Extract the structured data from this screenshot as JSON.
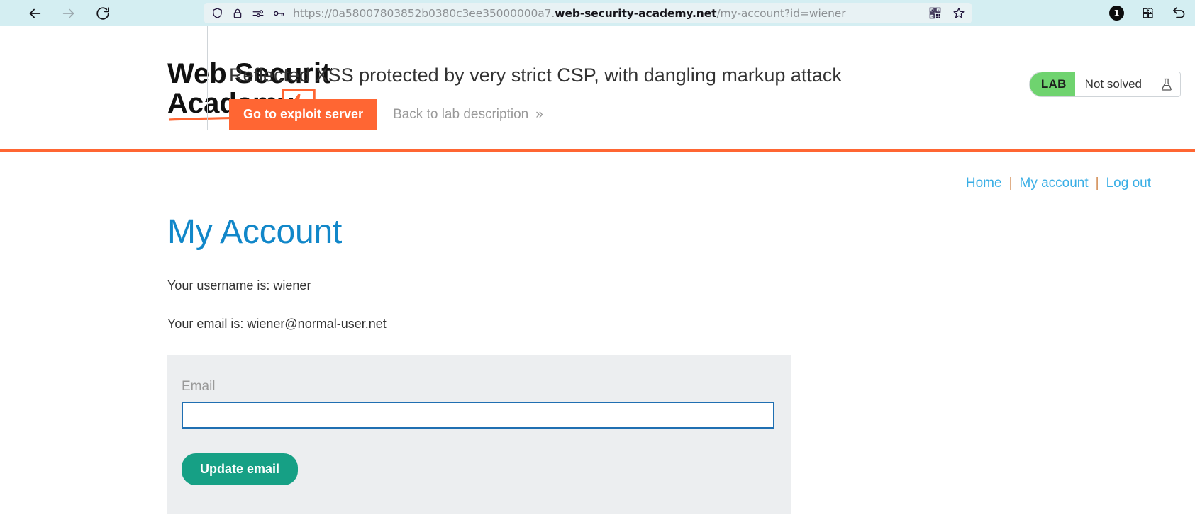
{
  "browser": {
    "back_label": "Back",
    "forward_label": "Forward",
    "reload_label": "Reload",
    "url_prefix": "https://0a58007803852b0380c3ee35000000a7.",
    "url_domain": "web-security-academy.net",
    "url_path": "/my-account?id=wiener",
    "url_full": "https://0a58007803852b0380c3ee35000000a7.web-security-academy.net/my-account?id=wiener",
    "icons": {
      "shield": "shield-icon",
      "lock": "lock-icon",
      "permissions": "permissions-icon",
      "key": "key-icon",
      "qr": "qr-code-icon",
      "bookmark": "bookmark-star-icon",
      "extension": "extension-icon",
      "history": "history-back-icon"
    },
    "notification_count": "1"
  },
  "lab": {
    "logo_line1": "Web Security",
    "logo_line2": "Academy",
    "title": "Reflected XSS protected by very strict CSP, with dangling markup attack",
    "exploit_button": "Go to exploit server",
    "back_link": "Back to lab description",
    "back_chevron": "»",
    "status_tag": "LAB",
    "status_state": "Not solved",
    "status_icon": "flask-icon",
    "accent_color": "#ff6633",
    "status_green": "#6fd36f"
  },
  "topnav": {
    "home": "Home",
    "my_account": "My account",
    "log_out": "Log out",
    "separator": "|",
    "link_color": "#39aee5"
  },
  "account": {
    "page_title": "My Account",
    "username_line": "Your username is: wiener",
    "email_line": "Your email is: wiener@normal-user.net",
    "form": {
      "email_label": "Email",
      "email_value": "",
      "email_placeholder": "",
      "submit_label": "Update email"
    }
  }
}
